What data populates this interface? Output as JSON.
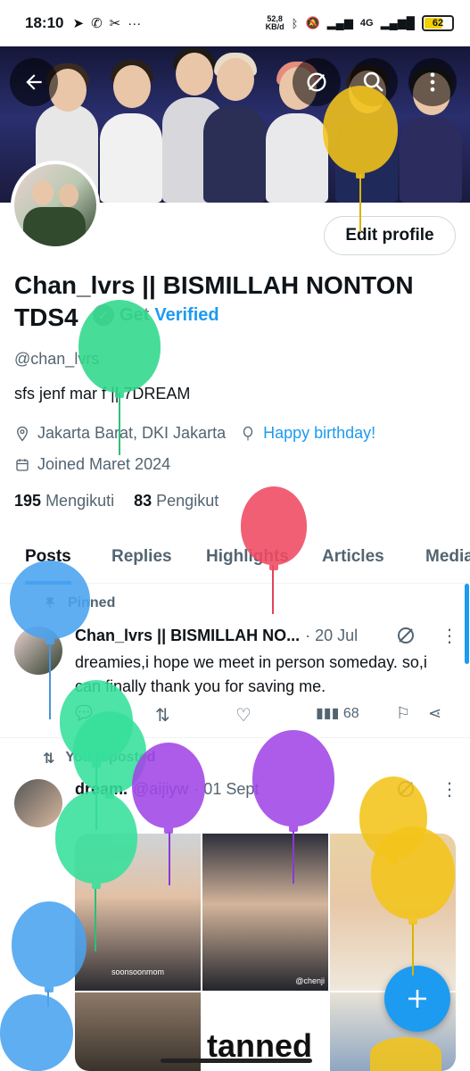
{
  "status_bar": {
    "time": "18:10",
    "net_speed_value": "52,8",
    "net_speed_unit": "KB/d",
    "network": "4G",
    "battery": "62"
  },
  "colors": {
    "accent": "#1d9bf0",
    "text": "#0f1419",
    "muted": "#536471"
  },
  "top_icons": {
    "back": "arrow-left-icon",
    "grok": "grok-icon",
    "search": "search-icon",
    "more": "more-vertical-icon"
  },
  "profile": {
    "edit_label": "Edit profile",
    "name": "Chan_lvrs || BISMILLAH NONTON TDS4",
    "get_verified_part1": "Get",
    "get_verified_part2": "Verified",
    "handle": "@chan_lvrs",
    "bio": "sfs  jenf mar  f || 7DREAM",
    "location": "Jakarta Barat, DKI Jakarta",
    "birthday": "Happy birthday!",
    "joined": "Joined Maret 2024",
    "following_count": "195",
    "following_label": "Mengikuti",
    "followers_count": "83",
    "followers_label": "Pengikut"
  },
  "tabs": [
    "Posts",
    "Replies",
    "Highlights",
    "Articles",
    "Media"
  ],
  "pinned_post": {
    "pinned_label": "Pinned",
    "author": "Chan_lvrs || BISMILLAH NO...",
    "date": "· 20 Jul",
    "text": "dreamies,i hope we meet in person someday. so,i can finally thank you for saving me.",
    "views": "68"
  },
  "repost": {
    "label": "You reposted",
    "author": "dream.",
    "handle": "@aijiyw",
    "date": "· 01 Sept",
    "image_caption_1": "soonsoonmom",
    "image_caption_2": "@chenji",
    "image_text": "tanned"
  },
  "fab": {
    "icon": "plus-icon"
  }
}
